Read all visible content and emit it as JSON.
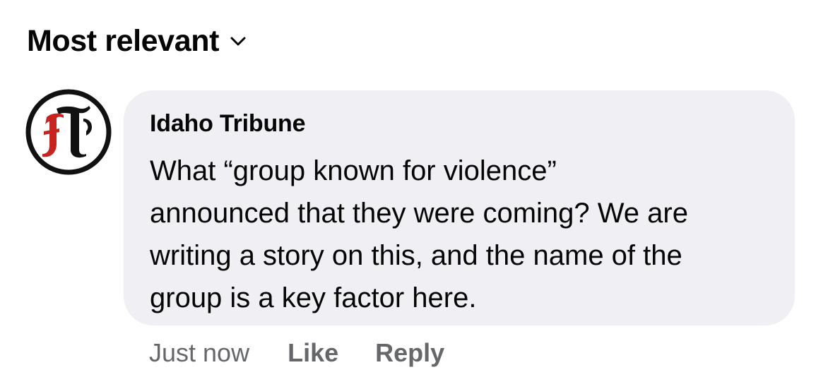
{
  "sort": {
    "label": "Most relevant",
    "icon": "chevron-down-icon"
  },
  "comment": {
    "avatar": {
      "icon": "idaho-tribune-logo",
      "monogram": "IT",
      "colors": {
        "ring": "#111111",
        "letter_i": "#c8241f",
        "letter_t": "#111111"
      }
    },
    "author": "Idaho Tribune",
    "text_lines": [
      "What “group known for violence”",
      "announced that they were coming? We are",
      "writing a story on this, and the name of the",
      "group is a key factor here."
    ],
    "timestamp": "Just now",
    "like_label": "Like",
    "reply_label": "Reply"
  },
  "colors": {
    "bubble_background": "#f0f0f4",
    "primary_text": "#050505",
    "secondary_text": "#65676b"
  }
}
